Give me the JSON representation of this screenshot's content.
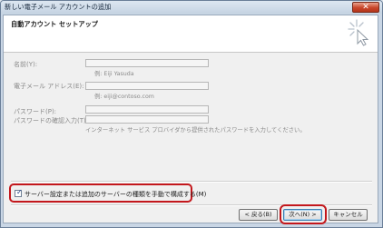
{
  "window": {
    "title": "新しい電子メール アカウントの追加",
    "close_glyph": "✕"
  },
  "header": {
    "title": "自動アカウント セットアップ",
    "icon": "cursor-sparkle-icon"
  },
  "form": {
    "name_label": "名前(Y):",
    "name_value": "",
    "name_hint": "例: Eiji Yasuda",
    "email_label": "電子メール アドレス(E):",
    "email_value": "",
    "email_hint": "例: eiji@contoso.com",
    "password_label": "パスワード(P):",
    "password_value": "",
    "password_confirm_label": "パスワードの確認入力(T):",
    "password_confirm_value": "",
    "password_hint": "インターネット サービス プロバイダから提供されたパスワードを入力してください。"
  },
  "manual_config": {
    "label": "サーバー設定または追加のサーバーの種類を手動で構成する(M)",
    "checked": true,
    "check_glyph": "✓"
  },
  "buttons": {
    "back": "< 戻る(B)",
    "next": "次へ(N) >",
    "cancel": "キャンセル"
  },
  "colors": {
    "highlight": "#c3171c",
    "close_button": "#c8452a"
  }
}
